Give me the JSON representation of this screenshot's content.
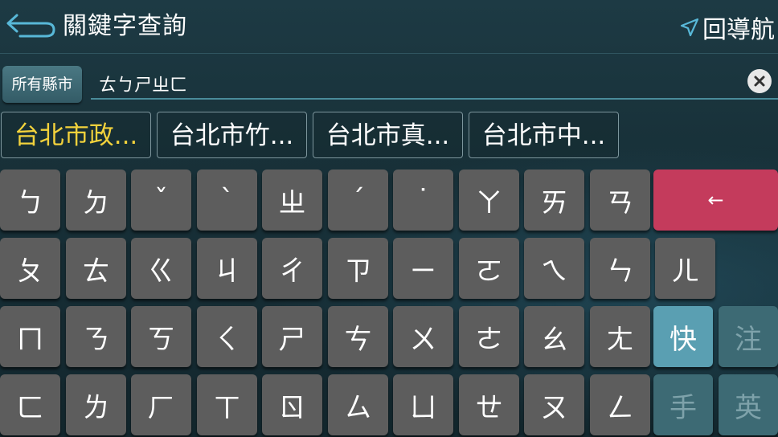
{
  "header": {
    "title": "關鍵字查詢",
    "nav_back_label": "回導航"
  },
  "search": {
    "region_label": "所有縣市",
    "value": "ㄊㄅㄕㄓㄈ"
  },
  "suggestions": [
    {
      "label": "台北市政..."
    },
    {
      "label": "台北市竹..."
    },
    {
      "label": "台北市真..."
    },
    {
      "label": "台北市中..."
    }
  ],
  "keyboard": {
    "row1": [
      "ㄅ",
      "ㄉ",
      "ˇ",
      "ˋ",
      "ㄓ",
      "ˊ",
      "˙",
      "ㄚ",
      "ㄞ",
      "ㄢ"
    ],
    "row2": [
      "ㄆ",
      "ㄊ",
      "ㄍ",
      "ㄐ",
      "ㄔ",
      "ㄗ",
      "ㄧ",
      "ㄛ",
      "ㄟ",
      "ㄣ",
      "ㄦ"
    ],
    "row3": [
      "ㄇ",
      "ㄋ",
      "ㄎ",
      "ㄑ",
      "ㄕ",
      "ㄘ",
      "ㄨ",
      "ㄜ",
      "ㄠ",
      "ㄤ"
    ],
    "row4": [
      "ㄈ",
      "ㄌ",
      "ㄏ",
      "ㄒ",
      "ㄖ",
      "ㄙ",
      "ㄩ",
      "ㄝ",
      "ㄡ",
      "ㄥ"
    ],
    "backspace_symbol": "←",
    "modes": {
      "quick": "快",
      "zhuyin": "注",
      "handwrite": "手",
      "english": "英"
    }
  },
  "colors": {
    "accent": "#4a8b9a",
    "backspace": "#c43b5c",
    "active_mode": "#5a9fb2",
    "highlight_text": "#f2d23c"
  }
}
